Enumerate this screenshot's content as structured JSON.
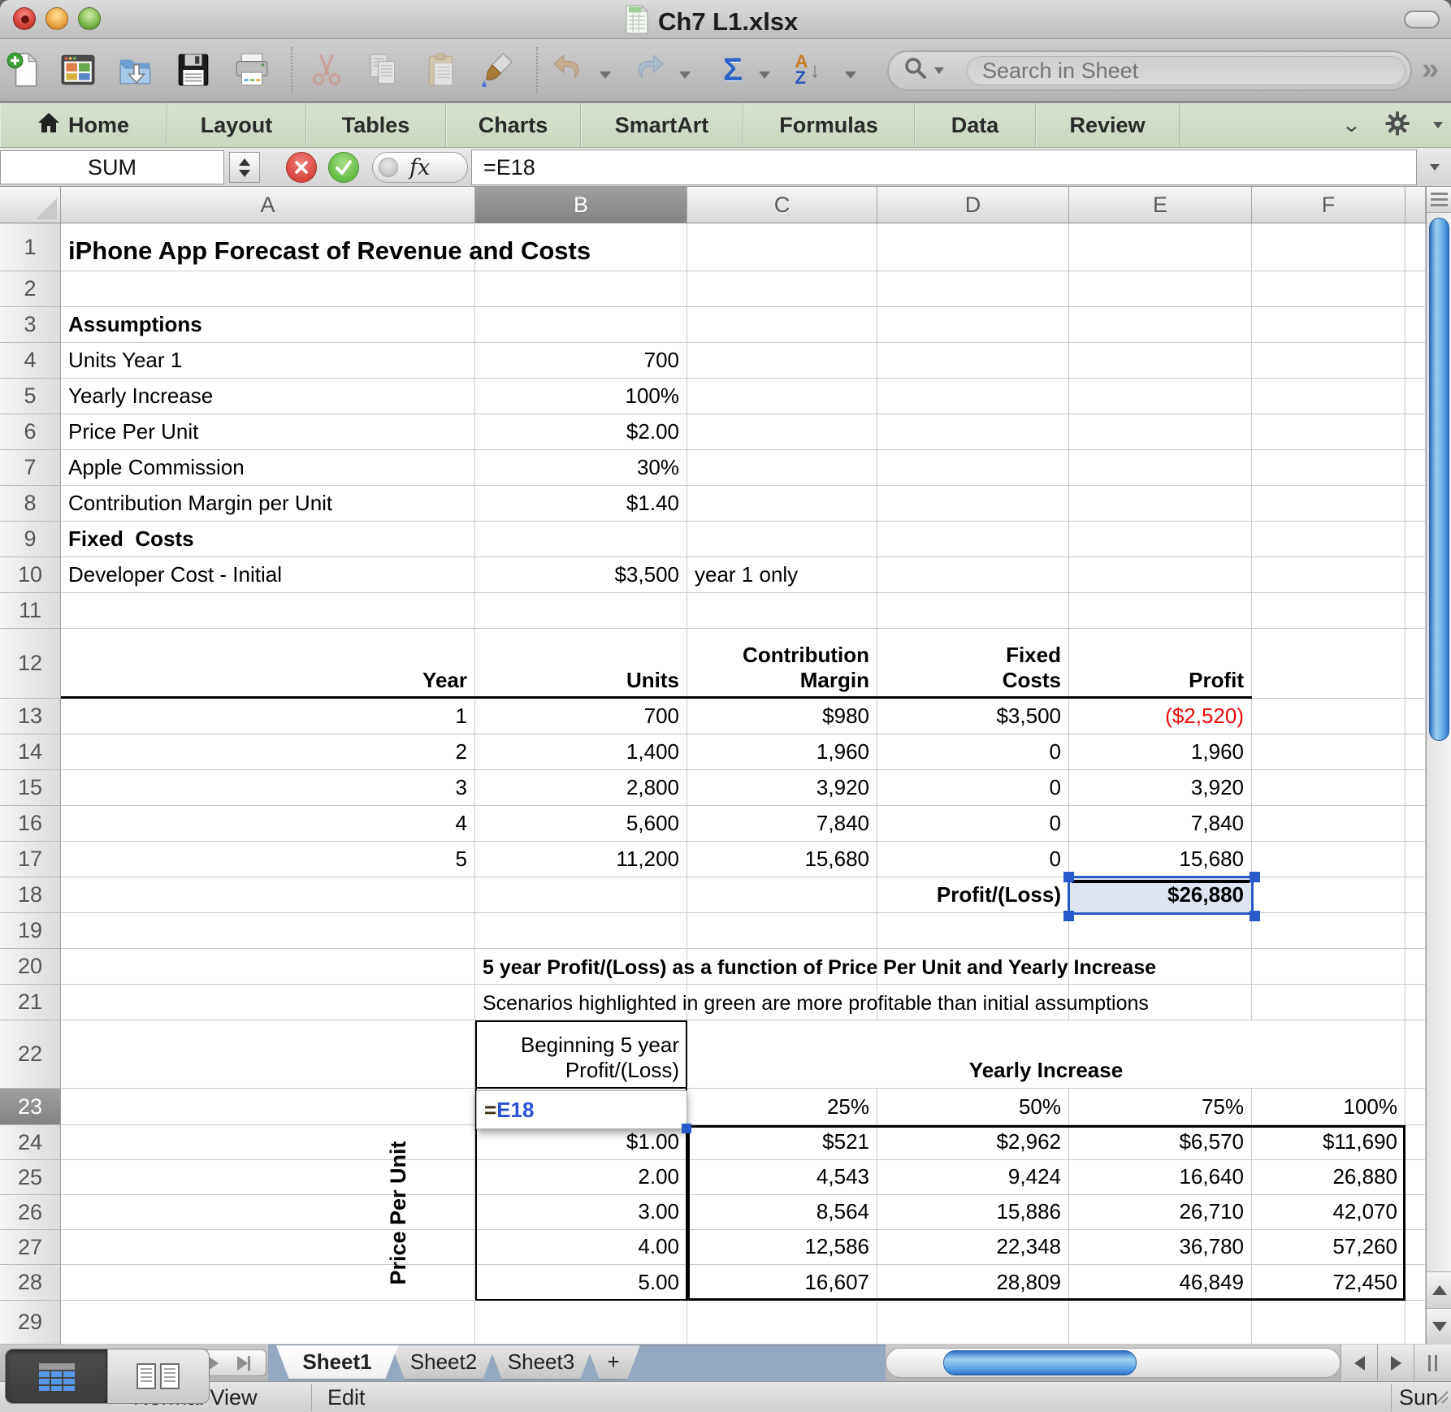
{
  "window": {
    "title": "Ch7 L1.xlsx"
  },
  "toolbar": {
    "left_icons": [
      "new-document",
      "template-gallery",
      "open",
      "save",
      "print",
      "cut",
      "copy",
      "paste",
      "format-painter",
      "undo",
      "redo"
    ],
    "autosum_label": "Σ",
    "sort_label_top": "A",
    "sort_label_bottom": "Z",
    "search_placeholder": "Search in Sheet",
    "more_label": "»"
  },
  "ribbon": {
    "tabs": [
      "Home",
      "Layout",
      "Tables",
      "Charts",
      "SmartArt",
      "Formulas",
      "Data",
      "Review"
    ]
  },
  "formula_bar": {
    "name_box": "SUM",
    "fx_label": "fx",
    "formula": "=E18"
  },
  "sheet": {
    "column_headers": [
      "A",
      "B",
      "C",
      "D",
      "E",
      "F"
    ],
    "selected_column": "B",
    "selected_row": 23,
    "selected_cell": "E18",
    "edit_cell": {
      "ref": "B23",
      "prefix": "=",
      "reference": "E18"
    },
    "vertical_label": "Price Per Unit",
    "cells": {
      "A1": {
        "t": "iPhone App Forecast of Revenue and Costs",
        "b": 1,
        "fs": 31,
        "spill": 1
      },
      "A3": {
        "t": "Assumptions",
        "b": 1
      },
      "A4": {
        "t": "Units Year 1"
      },
      "B4": {
        "t": "700",
        "al": "r"
      },
      "A5": {
        "t": "Yearly Increase"
      },
      "B5": {
        "t": "100%",
        "al": "r"
      },
      "A6": {
        "t": "Price Per Unit"
      },
      "B6": {
        "t": "$2.00",
        "al": "r"
      },
      "A7": {
        "t": "Apple Commission"
      },
      "B7": {
        "t": "30%",
        "al": "r"
      },
      "A8": {
        "t": "Contribution Margin per Unit"
      },
      "B8": {
        "t": "$1.40",
        "al": "r"
      },
      "A9": {
        "t": "Fixed  Costs",
        "b": 1
      },
      "A10": {
        "t": "Developer Cost - Initial"
      },
      "B10": {
        "t": "$3,500",
        "al": "r"
      },
      "C10": {
        "t": "year 1 only"
      },
      "A12": {
        "t": "Year",
        "b": 1,
        "al": "r"
      },
      "B12": {
        "t": "Units",
        "b": 1,
        "al": "r"
      },
      "C12": {
        "t": "Contribution\nMargin",
        "b": 1,
        "al": "r"
      },
      "D12": {
        "t": "Fixed\nCosts",
        "b": 1,
        "al": "r"
      },
      "E12": {
        "t": "Profit",
        "b": 1,
        "al": "r"
      },
      "A13": {
        "t": "1",
        "al": "r"
      },
      "B13": {
        "t": "700",
        "al": "r"
      },
      "C13": {
        "t": "$980",
        "al": "r"
      },
      "D13": {
        "t": "$3,500",
        "al": "r"
      },
      "E13": {
        "t": "($2,520)",
        "al": "r",
        "red": 1
      },
      "A14": {
        "t": "2",
        "al": "r"
      },
      "B14": {
        "t": "1,400",
        "al": "r"
      },
      "C14": {
        "t": "1,960",
        "al": "r"
      },
      "D14": {
        "t": "0",
        "al": "r"
      },
      "E14": {
        "t": "1,960",
        "al": "r"
      },
      "A15": {
        "t": "3",
        "al": "r"
      },
      "B15": {
        "t": "2,800",
        "al": "r"
      },
      "C15": {
        "t": "3,920",
        "al": "r"
      },
      "D15": {
        "t": "0",
        "al": "r"
      },
      "E15": {
        "t": "3,920",
        "al": "r"
      },
      "A16": {
        "t": "4",
        "al": "r"
      },
      "B16": {
        "t": "5,600",
        "al": "r"
      },
      "C16": {
        "t": "7,840",
        "al": "r"
      },
      "D16": {
        "t": "0",
        "al": "r"
      },
      "E16": {
        "t": "7,840",
        "al": "r"
      },
      "A17": {
        "t": "5",
        "al": "r"
      },
      "B17": {
        "t": "11,200",
        "al": "r"
      },
      "C17": {
        "t": "15,680",
        "al": "r"
      },
      "D17": {
        "t": "0",
        "al": "r"
      },
      "E17": {
        "t": "15,680",
        "al": "r"
      },
      "D18": {
        "t": "Profit/(Loss)",
        "b": 1,
        "al": "r"
      },
      "E18": {
        "t": "$26,880",
        "b": 1,
        "al": "r",
        "sel": 1
      },
      "B20": {
        "t": "5 year Profit/(Loss) as a function of Price Per Unit and Yearly Increase",
        "b": 1,
        "fs": 25,
        "spill": 1
      },
      "B21": {
        "t": "Scenarios highlighted in green are more profitable than initial assumptions",
        "fs": 25,
        "spill": 1
      },
      "B22": {
        "t": "Beginning 5 year\nProfit/(Loss)",
        "al": "r"
      },
      "C22": {
        "t": "Yearly Increase",
        "b": 1,
        "al": "c",
        "span": 4
      },
      "C23": {
        "t": "25%",
        "al": "r"
      },
      "D23": {
        "t": "50%",
        "al": "r"
      },
      "E23": {
        "t": "75%",
        "al": "r"
      },
      "F23": {
        "t": "100%",
        "al": "r"
      },
      "B24": {
        "t": "$1.00",
        "al": "r"
      },
      "C24": {
        "t": "$521",
        "al": "r"
      },
      "D24": {
        "t": "$2,962",
        "al": "r"
      },
      "E24": {
        "t": "$6,570",
        "al": "r"
      },
      "F24": {
        "t": "$11,690",
        "al": "r"
      },
      "B25": {
        "t": "2.00",
        "al": "r"
      },
      "C25": {
        "t": "4,543",
        "al": "r"
      },
      "D25": {
        "t": "9,424",
        "al": "r"
      },
      "E25": {
        "t": "16,640",
        "al": "r"
      },
      "F25": {
        "t": "26,880",
        "al": "r"
      },
      "B26": {
        "t": "3.00",
        "al": "r"
      },
      "C26": {
        "t": "8,564",
        "al": "r"
      },
      "D26": {
        "t": "15,886",
        "al": "r"
      },
      "E26": {
        "t": "26,710",
        "al": "r"
      },
      "F26": {
        "t": "42,070",
        "al": "r"
      },
      "B27": {
        "t": "4.00",
        "al": "r"
      },
      "C27": {
        "t": "12,586",
        "al": "r"
      },
      "D27": {
        "t": "22,348",
        "al": "r"
      },
      "E27": {
        "t": "36,780",
        "al": "r"
      },
      "F27": {
        "t": "57,260",
        "al": "r"
      },
      "B28": {
        "t": "5.00",
        "al": "r"
      },
      "C28": {
        "t": "16,607",
        "al": "r"
      },
      "D28": {
        "t": "28,809",
        "al": "r"
      },
      "E28": {
        "t": "46,849",
        "al": "r"
      },
      "F28": {
        "t": "72,450",
        "al": "r"
      }
    }
  },
  "sheet_tabs": {
    "tabs": [
      "Sheet1",
      "Sheet2",
      "Sheet3"
    ],
    "active": "Sheet1",
    "add_label": "+"
  },
  "status_bar": {
    "view_mode": "Normal View",
    "edit_mode": "Edit",
    "clock": "Sun"
  },
  "colors": {
    "accent_blue": "#2759c9",
    "negative_red": "#e80b07",
    "ribbon_green": "#cfdeca",
    "tab_strip_blue": "#94a8bf",
    "scroll_thumb_blue": "#5ba4e6"
  }
}
